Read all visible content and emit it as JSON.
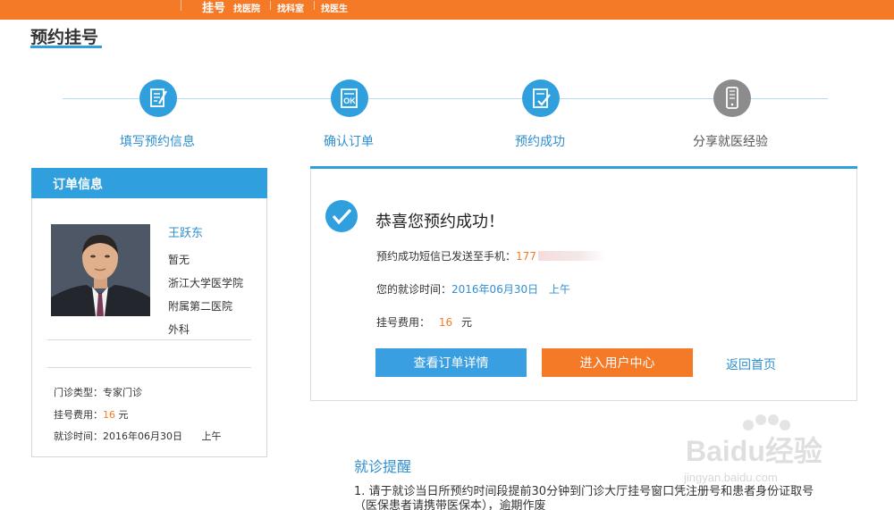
{
  "topbar": {
    "brand": "挂号",
    "nav": [
      "找医院",
      "找科室",
      "找医生"
    ]
  },
  "page": {
    "title": "预约挂号"
  },
  "steps": [
    {
      "label": "填写预约信息",
      "icon": "form-edit-icon",
      "active": true
    },
    {
      "label": "确认订单",
      "icon": "ok-icon",
      "active": true
    },
    {
      "label": "预约成功",
      "icon": "check-document-icon",
      "active": true
    },
    {
      "label": "分享就医经验",
      "icon": "phone-icon",
      "active": false
    }
  ],
  "order": {
    "header": "订单信息",
    "doctor_name": "王跃东",
    "doctor_title": "暂无",
    "hospital_line1": "浙江大学医学院",
    "hospital_line2": "附属第二医院",
    "department": "外科",
    "clinic_type_label": "门诊类型：",
    "clinic_type_value": "专家门诊",
    "fee_label": "挂号费用：",
    "fee_value": "16",
    "fee_unit": "元",
    "time_label": "就诊时间：",
    "time_date": "2016年06月30日",
    "time_period": "上午"
  },
  "success": {
    "title": "恭喜您预约成功！",
    "sms_label": "预约成功短信已发送至手机：",
    "sms_phone_visible": "177",
    "time_label": "您的就诊时间：",
    "time_date": "2016年06月30日",
    "time_period": "上午",
    "fee_label": "挂号费用：",
    "fee_value": "16",
    "fee_unit": "元",
    "btn_details": "查看订单详情",
    "btn_user_center": "进入用户中心",
    "link_home": "返回首页"
  },
  "reminder": {
    "title": "就诊提醒",
    "items": [
      "1.   请于就诊当日所预约时间段提前30分钟到门诊大厅挂号窗口凭注册号和患者身份证取号（医保患者请携带医保本），逾期作废"
    ]
  },
  "watermark": {
    "line1": "Baidu经验",
    "line2": "jingyan.baidu.com"
  },
  "colors": {
    "accent": "#2f9fde",
    "orange": "#f47a27",
    "grey": "#8c8c8c"
  }
}
